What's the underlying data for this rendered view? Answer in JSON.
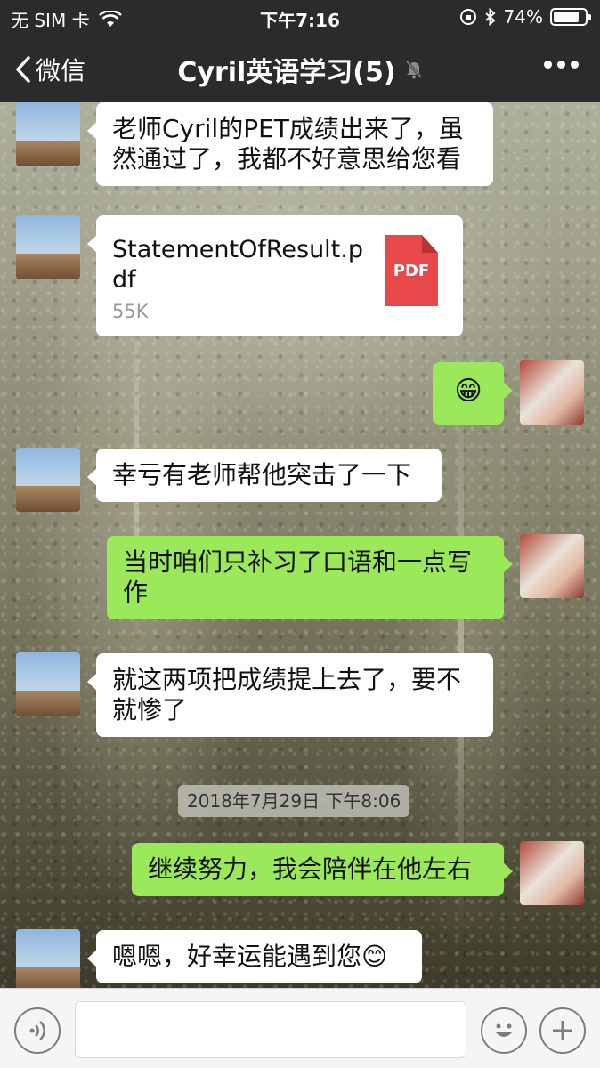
{
  "status_bar": {
    "carrier": "无 SIM 卡",
    "time": "下午7:16",
    "battery": "74%",
    "battery_level": 0.74
  },
  "nav": {
    "back_label": "微信",
    "title": "Cyril英语学习(5)"
  },
  "messages": [
    {
      "side": "left",
      "text": "老师Cyril的PET成绩出来了，虽然通过了，我都不好意思给您看"
    },
    {
      "side": "left",
      "type": "file",
      "file_name": "StatementOfResult.pdf",
      "file_size": "55K",
      "file_badge": "PDF"
    },
    {
      "side": "right",
      "type": "emoji",
      "emoji": "😁"
    },
    {
      "side": "left",
      "text": "幸亏有老师帮他突击了一下"
    },
    {
      "side": "right",
      "text": "当时咱们只补习了口语和一点写作"
    },
    {
      "side": "left",
      "text": "就这两项把成绩提上去了，要不就惨了"
    },
    {
      "side": "right",
      "text": "继续努力，我会陪伴在他左右"
    },
    {
      "side": "left",
      "text": "嗯嗯，好幸运能遇到您😊"
    }
  ],
  "timestamp": "2018年7月29日 下午8:06",
  "colors": {
    "bar_bg": "#2b2b2e",
    "bubble_self": "#9be85b",
    "bubble_other": "#ffffff",
    "pdf_red": "#e7494a"
  }
}
